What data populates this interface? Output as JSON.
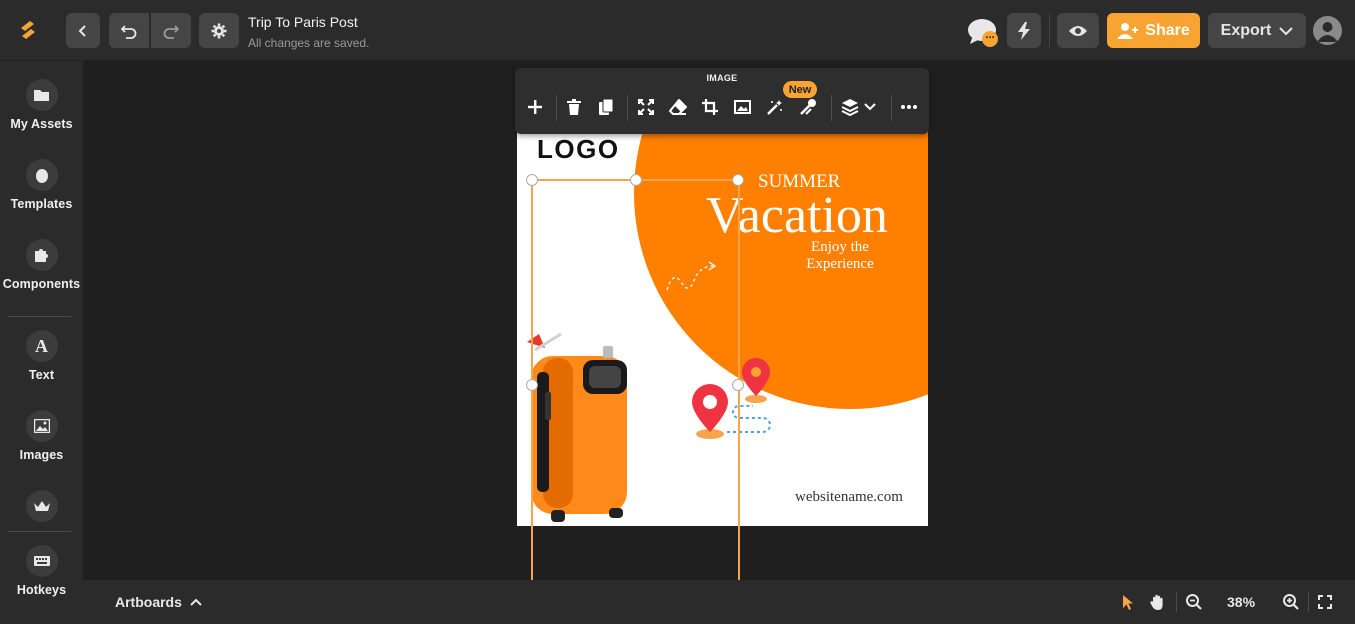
{
  "header": {
    "doc_title": "Trip To Paris Post",
    "doc_status": "All changes are saved.",
    "share_label": "Share",
    "export_label": "Export",
    "comment_badge": "..."
  },
  "sidebar": {
    "items": [
      {
        "label": "My Assets",
        "icon": "folder-icon"
      },
      {
        "label": "Templates",
        "icon": "egg-icon"
      },
      {
        "label": "Components",
        "icon": "puzzle-icon"
      },
      {
        "label": "Text",
        "icon": "text-icon"
      },
      {
        "label": "Images",
        "icon": "image-icon"
      },
      {
        "label": "",
        "icon": "crown-icon"
      },
      {
        "label": "Hotkeys",
        "icon": "keyboard-icon"
      }
    ]
  },
  "float_toolbar": {
    "title": "IMAGE",
    "new_badge": "New"
  },
  "artboard": {
    "logo": "LOGO",
    "summer": "SUMMER",
    "vacation": "Vacation",
    "enjoy_line1": "Enjoy the",
    "enjoy_line2": "Experience",
    "website": "websitename.com",
    "accent_color": "#ff7f00"
  },
  "bottombar": {
    "artboards_label": "Artboards",
    "zoom": "38%"
  },
  "colors": {
    "brand": "#f7a432",
    "bg": "#1f1f1f",
    "panel": "#2b2b2b"
  }
}
